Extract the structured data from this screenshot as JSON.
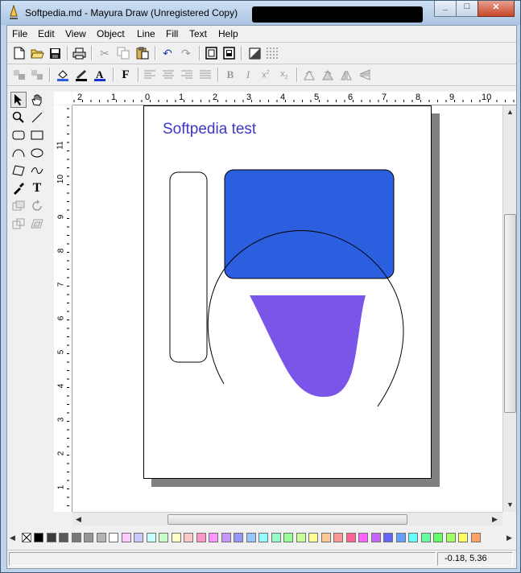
{
  "window": {
    "title": "Softpedia.md - Mayura Draw (Unregistered Copy)",
    "buttons": [
      "minimize",
      "maximize",
      "close"
    ]
  },
  "menu": [
    "File",
    "Edit",
    "View",
    "Object",
    "Line",
    "Fill",
    "Text",
    "Help"
  ],
  "toolbar1": [
    "new-file-icon",
    "open-folder-icon",
    "save-icon",
    "print-icon",
    "cut-icon",
    "copy-icon",
    "paste-icon",
    "undo-icon",
    "redo-icon",
    "page-setup-icon",
    "page-properties-icon",
    "fill-pattern-icon",
    "grid-icon"
  ],
  "toolbar2": {
    "font_button": "F",
    "bold": "B",
    "italic": "I",
    "superscript": "x2",
    "subscript": "x2"
  },
  "tools": [
    "pointer-tool-icon",
    "hand-tool-icon",
    "zoom-tool-icon",
    "line-tool-icon",
    "rounded-rect-tool-icon",
    "rectangle-tool-icon",
    "arc-tool-icon",
    "ellipse-tool-icon",
    "polygon-tool-icon",
    "curve-tool-icon",
    "eyedropper-tool-icon",
    "text-tool-icon",
    "image-tool-icon",
    "rotate-tool-icon",
    "transform-tool-icon"
  ],
  "text_tool_label": "T",
  "ruler": {
    "horizontal": [
      "2",
      "1",
      "0",
      "1",
      "2",
      "3",
      "4",
      "5",
      "6",
      "7",
      "8",
      "9",
      "10"
    ],
    "vertical": [
      "11",
      "10",
      "9",
      "8",
      "7",
      "6",
      "5",
      "4",
      "3",
      "2",
      "1",
      "0"
    ]
  },
  "canvas": {
    "text": "Softpedia test",
    "text_color": "#3d37c8",
    "rect_fill": "#2b5fe0",
    "shape_fill": "#7b55e8"
  },
  "palette": [
    "#000000",
    "#3c3c3c",
    "#5a5a5a",
    "#787878",
    "#969696",
    "#b4b4b4",
    "#ffffff",
    "#ffc8ff",
    "#c8c8ff",
    "#c8ffff",
    "#c8ffc8",
    "#ffffc8",
    "#ffc8c8",
    "#ff96c8",
    "#ff96ff",
    "#c896ff",
    "#9696ff",
    "#96c8ff",
    "#96ffff",
    "#96ffc8",
    "#96ff96",
    "#c8ff96",
    "#ffff96",
    "#ffc896",
    "#ff9696",
    "#ff6496",
    "#ff64ff",
    "#c864ff",
    "#6464ff",
    "#64a0ff",
    "#64ffff",
    "#64ffa0",
    "#64ff64",
    "#a0ff64",
    "#ffff64",
    "#ffa064"
  ],
  "status": {
    "coords": "-0.18, 5.36"
  }
}
